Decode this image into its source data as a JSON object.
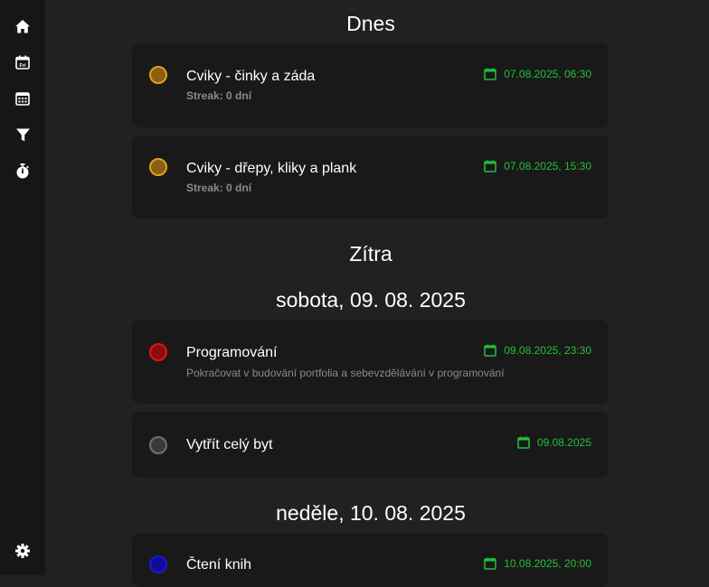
{
  "colors": {
    "background": "#212121",
    "sidebar": "#161616",
    "card": "#191919",
    "date_green": "#22c03a",
    "circle_orange": "#8b5e10",
    "circle_red": "#8a0c0c",
    "circle_gray": "#3a3a3a",
    "circle_blue": "#0d0d9a"
  },
  "sidebar": {
    "items": [
      {
        "icon": "home-icon"
      },
      {
        "icon": "calendar-fri-icon",
        "label": "Fri"
      },
      {
        "icon": "calendar-grid-icon"
      },
      {
        "icon": "filter-icon"
      },
      {
        "icon": "stopwatch-icon"
      }
    ],
    "settings_icon": "gear-icon"
  },
  "sections": {
    "today": "Dnes",
    "tomorrow": "Zítra",
    "saturday": "sobota, 09. 08. 2025",
    "sunday": "neděle, 10. 08. 2025"
  },
  "tasks": [
    {
      "title": "Cviky - činky a záda",
      "subtitle": "Streak: 0 dní",
      "date": "07.08.2025, 06:30",
      "color": "orange"
    },
    {
      "title": "Cviky - dřepy, kliky a plank",
      "subtitle": "Streak: 0 dní",
      "date": "07.08.2025, 15:30",
      "color": "orange"
    },
    {
      "title": "Programování",
      "subtitle": "Pokračovat v budování portfolia a sebevzdělávání v programování",
      "date": "09.08.2025, 23:30",
      "color": "red"
    },
    {
      "title": "Vytřít celý byt",
      "subtitle": "",
      "date": "09.08.2025",
      "color": "gray"
    },
    {
      "title": "Čtení knih",
      "subtitle": "",
      "date": "10.08.2025, 20:00",
      "color": "blue"
    }
  ]
}
